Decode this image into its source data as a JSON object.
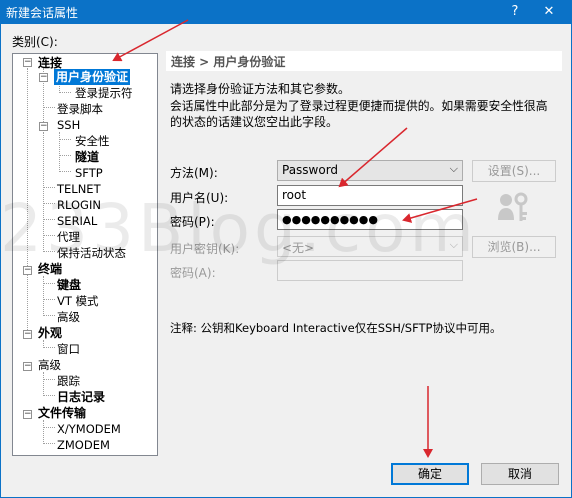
{
  "window": {
    "title": "新建会话属性",
    "help_label": "?",
    "close_label": "✕"
  },
  "category_label": "类别(C):",
  "tree": {
    "connection": "连接",
    "user_auth": "用户身份验证",
    "login_prompts": "登录提示符",
    "login_script": "登录脚本",
    "ssh": "SSH",
    "security": "安全性",
    "tunnel": "隧道",
    "sftp": "SFTP",
    "telnet": "TELNET",
    "rlogin": "RLOGIN",
    "serial": "SERIAL",
    "proxy": "代理",
    "keepalive": "保持活动状态",
    "terminal": "终端",
    "keyboard": "键盘",
    "vt_mode": "VT 模式",
    "advanced_term": "高级",
    "appearance": "外观",
    "window": "窗口",
    "advanced": "高级",
    "tracing": "跟踪",
    "logging": "日志记录",
    "file_transfer": "文件传输",
    "xymodem": "X/YMODEM",
    "zmodem": "ZMODEM",
    "expand_sign": "−"
  },
  "breadcrumb": "连接 > 用户身份验证",
  "description": {
    "line1": "请选择身份验证方法和其它参数。",
    "line2": "会话属性中此部分是为了登录过程更便捷而提供的。如果需要安全性很高",
    "line3": "的状态的话建议您空出此字段。"
  },
  "form": {
    "method_label": "方法(M):",
    "method_value": "Password",
    "settings_button": "设置(S)...",
    "username_label": "用户名(U):",
    "username_value": "root",
    "password_label": "密码(P):",
    "password_value": "●●●●●●●●●●",
    "user_key_label": "用户密钥(K):",
    "user_key_value": "<无>",
    "browse_button": "浏览(B)...",
    "passphrase_label": "密码(A):",
    "passphrase_value": ""
  },
  "note": "注释: 公钥和Keyboard Interactive仅在SSH/SFTP协议中可用。",
  "buttons": {
    "ok": "确定",
    "cancel": "取消"
  },
  "watermark": "233Blog.com",
  "colors": {
    "titlebar": "#0b72c7",
    "selection": "#0078d7",
    "annotation_arrow": "#d9272e"
  }
}
